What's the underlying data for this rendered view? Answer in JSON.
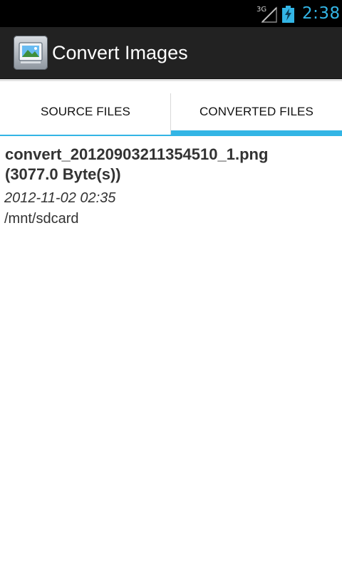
{
  "status_bar": {
    "network": "3G",
    "network_icon": "signal-icon",
    "battery_icon": "battery-charging-icon",
    "time": "2:38",
    "time_color": "#33b5e5"
  },
  "action_bar": {
    "title": "Convert Images",
    "icon": "image-icon",
    "background_color": "#222222"
  },
  "tabs": [
    {
      "label": "SOURCE FILES",
      "selected": false
    },
    {
      "label": "CONVERTED FILES",
      "selected": true
    }
  ],
  "files": [
    {
      "name": "convert_20120903211354510_1.png",
      "size": "(3077.0 Byte(s))",
      "date": "2012-11-02 02:35",
      "path": "/mnt/sdcard"
    }
  ],
  "colors": {
    "accent": "#33b5e5",
    "text": "#333333"
  }
}
